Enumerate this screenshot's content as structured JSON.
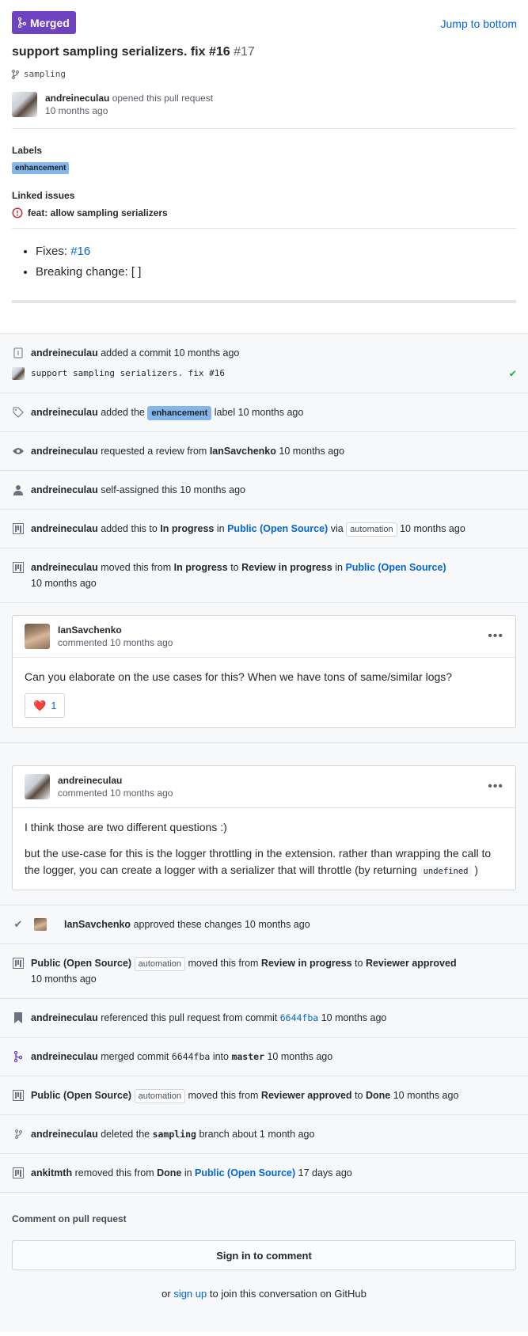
{
  "header": {
    "state": "Merged",
    "jump": "Jump to bottom",
    "title": "support sampling serializers. fix #16",
    "number": "#17",
    "branch": "sampling"
  },
  "opener": {
    "user": "andreineculau",
    "action": "opened this pull request",
    "time": "10 months ago"
  },
  "labels": {
    "heading": "Labels",
    "items": [
      "enhancement"
    ]
  },
  "linked": {
    "heading": "Linked issues",
    "items": [
      "feat: allow sampling serializers"
    ]
  },
  "body": {
    "fixes_label": "Fixes:",
    "fixes_link": "#16",
    "breaking": "Breaking change: [ ]"
  },
  "events": {
    "e1": {
      "user": "andreineculau",
      "text": "added a commit",
      "time": "10 months ago",
      "commit": "support sampling serializers. fix #16"
    },
    "e2": {
      "user": "andreineculau",
      "pre": "added the",
      "label": "enhancement",
      "post": "label",
      "time": "10 months ago"
    },
    "e3": {
      "user": "andreineculau",
      "text": "requested a review from",
      "target": "IanSavchenko",
      "time": "10 months ago"
    },
    "e4": {
      "user": "andreineculau",
      "text": "self-assigned this",
      "time": "10 months ago"
    },
    "e5": {
      "user": "andreineculau",
      "pre": "added this to",
      "column": "In progress",
      "in": "in",
      "project": "Public (Open Source)",
      "via": "via",
      "tag": "automation",
      "time": "10 months ago"
    },
    "e6": {
      "user": "andreineculau",
      "pre": "moved this from",
      "from": "In progress",
      "to_word": "to",
      "to": "Review in progress",
      "in": "in",
      "project": "Public (Open Source)",
      "time": "10 months ago"
    },
    "e7": {
      "user": "IanSavchenko",
      "text": "approved these changes",
      "time": "10 months ago"
    },
    "e8": {
      "user": "Public (Open Source)",
      "tag": "automation",
      "pre": "moved this from",
      "from": "Review in progress",
      "to_word": "to",
      "to": "Reviewer approved",
      "time": "10 months ago"
    },
    "e9": {
      "user": "andreineculau",
      "text": "referenced this pull request from commit",
      "sha": "6644fba",
      "time": "10 months ago"
    },
    "e10": {
      "user": "andreineculau",
      "pre": "merged commit",
      "sha": "6644fba",
      "into": "into",
      "branch": "master",
      "time": "10 months ago"
    },
    "e11": {
      "user": "Public (Open Source)",
      "tag": "automation",
      "pre": "moved this from",
      "from": "Reviewer approved",
      "to_word": "to",
      "to": "Done",
      "time": "10 months ago"
    },
    "e12": {
      "user": "andreineculau",
      "pre": "deleted the",
      "branch": "sampling",
      "post": "branch",
      "time": "about 1 month ago"
    },
    "e13": {
      "user": "ankitmth",
      "pre": "removed this from",
      "column": "Done",
      "in": "in",
      "project": "Public (Open Source)",
      "time": "17 days ago"
    }
  },
  "comments": {
    "c1": {
      "user": "IanSavchenko",
      "meta": "commented 10 months ago",
      "body": "Can you elaborate on the use cases for this? When we have tons of same/similar logs?",
      "reaction_count": "1"
    },
    "c2": {
      "user": "andreineculau",
      "meta": "commented 10 months ago",
      "p1": "I think those are two different questions :)",
      "p2": "but the use-case for this is the logger throttling in the extension. rather than wrapping the call to the logger, you can create a logger with a serializer that will throttle (by returning",
      "code": "undefined",
      "p2_end": ")"
    }
  },
  "footer": {
    "comment_heading": "Comment on pull request",
    "signin": "Sign in to comment",
    "pre": "or",
    "signup": "sign up",
    "post": "to join this conversation on GitHub"
  },
  "colors": {
    "merged": "#6f42c1",
    "link": "#0366d6",
    "label": "#84b6eb",
    "check": "#28a745"
  }
}
